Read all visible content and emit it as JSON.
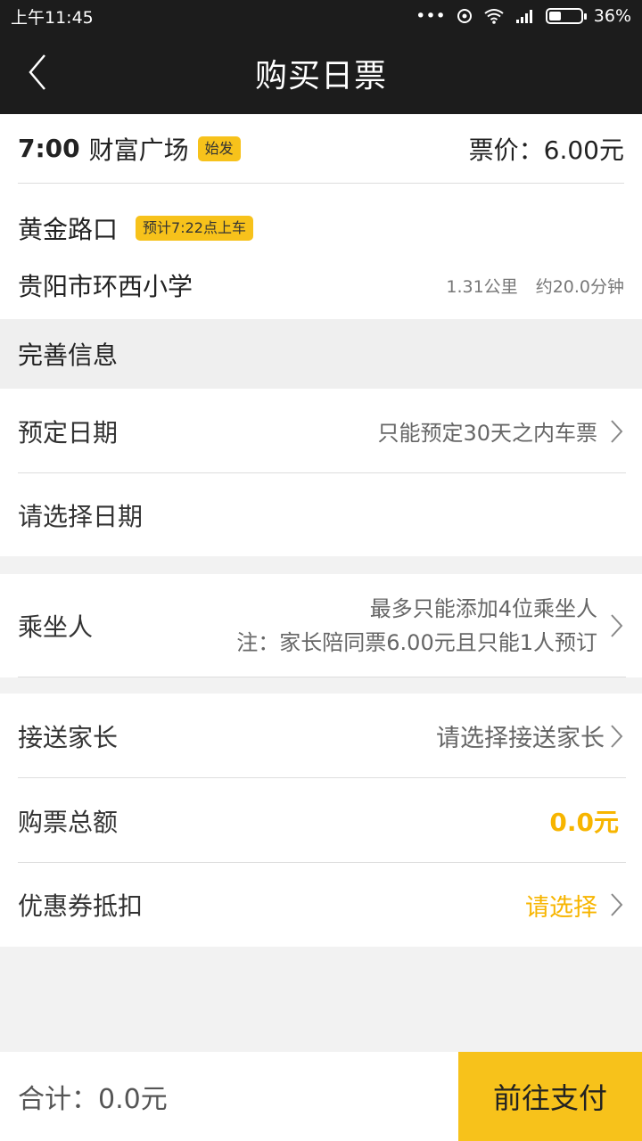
{
  "status_bar": {
    "time": "上午11:45",
    "battery": "36%",
    "dots": "•••"
  },
  "nav": {
    "title": "购买日票"
  },
  "trip": {
    "time": "7:00",
    "origin": "财富广场",
    "origin_badge": "始发",
    "price_label": "票价：6.00元",
    "stop": "黄金路口",
    "stop_badge": "预计7:22点上车",
    "destination": "贵阳市环西小学",
    "distance": "1.31公里",
    "duration": "约20.0分钟"
  },
  "section_header": "完善信息",
  "rows": {
    "date": {
      "label": "预定日期",
      "value": "只能预定30天之内车票"
    },
    "choose_date": {
      "label": "请选择日期"
    },
    "passengers": {
      "label": "乘坐人",
      "line1": "最多只能添加4位乘坐人",
      "line2": "注：家长陪同票6.00元且只能1人预订"
    },
    "parent": {
      "label": "接送家长",
      "value": "请选择接送家长"
    },
    "total": {
      "label": "购票总额",
      "value": "0.0元"
    },
    "coupon": {
      "label": "优惠券抵扣",
      "value": "请选择"
    }
  },
  "bottom": {
    "total": "合计：0.0元",
    "pay": "前往支付"
  },
  "colors": {
    "accent": "#f7c21b",
    "header": "#1c1c1c",
    "highlight_text": "#f7b500"
  }
}
